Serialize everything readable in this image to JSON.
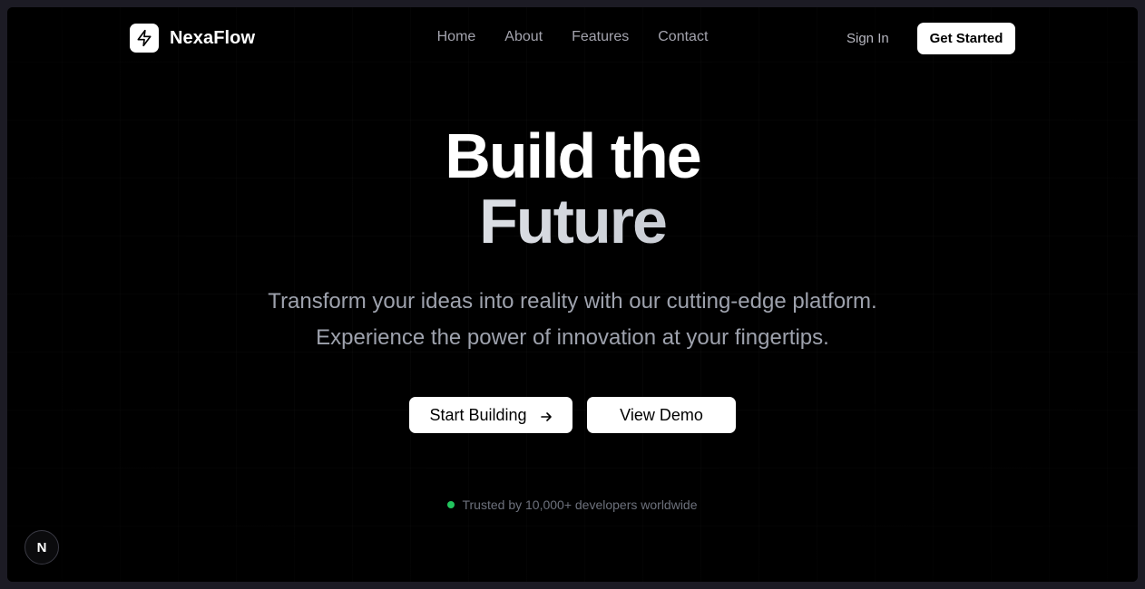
{
  "brand": {
    "name": "NexaFlow",
    "logo_icon": "lightning-bolt-icon"
  },
  "nav": {
    "links": [
      "Home",
      "About",
      "Features",
      "Contact"
    ],
    "sign_in": "Sign In",
    "get_started": "Get Started"
  },
  "hero": {
    "title_line1": "Build the",
    "title_line2": "Future",
    "subtitle_line1": "Transform your ideas into reality with our cutting-edge platform.",
    "subtitle_line2": "Experience the power of innovation at your fingertips.",
    "primary_cta": "Start Building",
    "primary_cta_icon": "arrow-right-icon",
    "secondary_cta": "View Demo"
  },
  "trust": {
    "text": "Trusted by 10,000+ developers worldwide",
    "indicator_color": "#22c55e"
  },
  "dev_badge": {
    "letter": "N",
    "icon": "nextjs-icon"
  },
  "colors": {
    "background": "#000000",
    "accent": "#ffffff",
    "muted_text": "#a3a3ad"
  }
}
